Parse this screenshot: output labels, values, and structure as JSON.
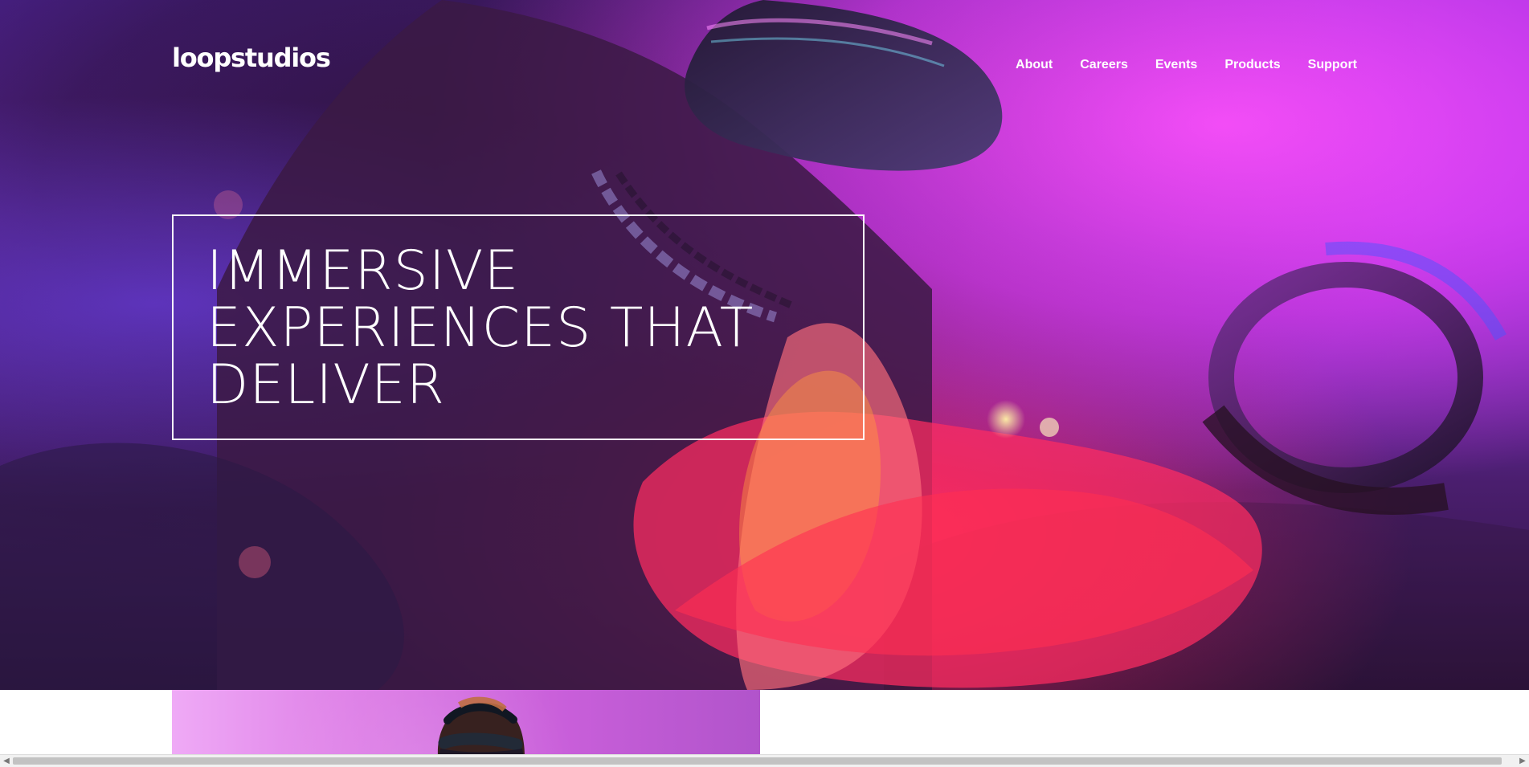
{
  "site": {
    "logo": "loopstudios"
  },
  "nav": {
    "links": [
      {
        "label": "About"
      },
      {
        "label": "Careers"
      },
      {
        "label": "Events"
      },
      {
        "label": "Products"
      },
      {
        "label": "Support"
      }
    ]
  },
  "hero": {
    "headline": "IMMERSIVE EXPERIENCES THAT DELIVER",
    "image": "vr-person-neon-hero"
  },
  "preview": {
    "image": "vr-person-preview"
  },
  "scrollbar": {
    "left_icon": "triangle-left-icon",
    "right_icon": "triangle-right-icon",
    "left_glyph": "◀",
    "right_glyph": "▶"
  },
  "colors": {
    "text": "#ffffff",
    "hero_magenta": "#ff50ff",
    "hero_pink": "#ff286e",
    "hero_purple": "#6b30d8",
    "hero_dark": "#2e133d"
  }
}
